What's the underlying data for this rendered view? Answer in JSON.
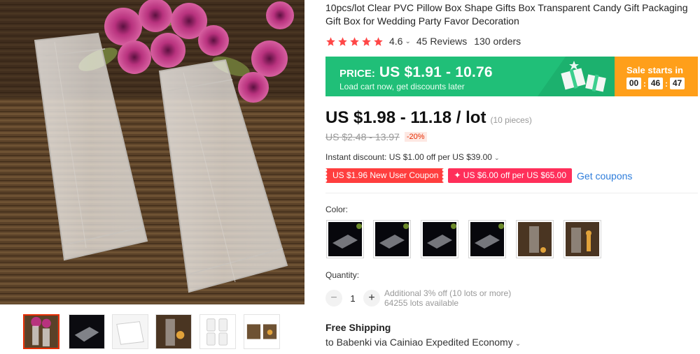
{
  "product": {
    "title": "10pcs/lot Clear PVC Pillow Box Shape Gifts Box Transparent Candy Gift Packaging Gift Box for Wedding Party Favor Decoration",
    "rating": "4.6",
    "reviews": "45 Reviews",
    "orders": "130 orders",
    "star_color": "#ff4747"
  },
  "promo": {
    "price_label": "PRICE:",
    "price_range": "US $1.91 - 10.76",
    "sub_text": "Load cart now, get discounts later",
    "sale_label": "Sale starts in",
    "countdown": {
      "hours": "00",
      "minutes": "46",
      "seconds": "47"
    },
    "colors": {
      "green": "#20bf78",
      "orange": "#ff9f1a"
    }
  },
  "pricing": {
    "current": "US $1.98 - 11.18 / lot",
    "pieces": "(10 pieces)",
    "original": "US $2.48 - 13.97",
    "discount": "-20%"
  },
  "instant_discount": "Instant discount: US $1.00 off per US $39.00",
  "coupons": {
    "new_user": "US $1.96 New User Coupon",
    "store": "✦ US $6.00 off per US $65.00",
    "get_link": "Get coupons"
  },
  "variants": {
    "label": "Color:",
    "swatches": [
      {
        "icon": "black-box-swatch"
      },
      {
        "icon": "black-box-swatch"
      },
      {
        "icon": "black-box-swatch"
      },
      {
        "icon": "black-box-swatch"
      },
      {
        "icon": "wood-box-swatch"
      },
      {
        "icon": "wood-box-giraffe-swatch"
      }
    ]
  },
  "quantity": {
    "label": "Quantity:",
    "value": "1",
    "minus": "−",
    "plus": "+",
    "additional": "Additional 3% off (10 lots or more)",
    "available": "64255 lots available"
  },
  "shipping": {
    "title": "Free Shipping",
    "desc": "to Babenki via Cainiao Expedited Economy"
  },
  "gallery": {
    "thumbnails": [
      "roses-boxes-thumb",
      "black-box-thumb",
      "pillow-box-thumb",
      "wood-box-thumb",
      "four-boxes-thumb",
      "wood-pair-thumb"
    ]
  }
}
